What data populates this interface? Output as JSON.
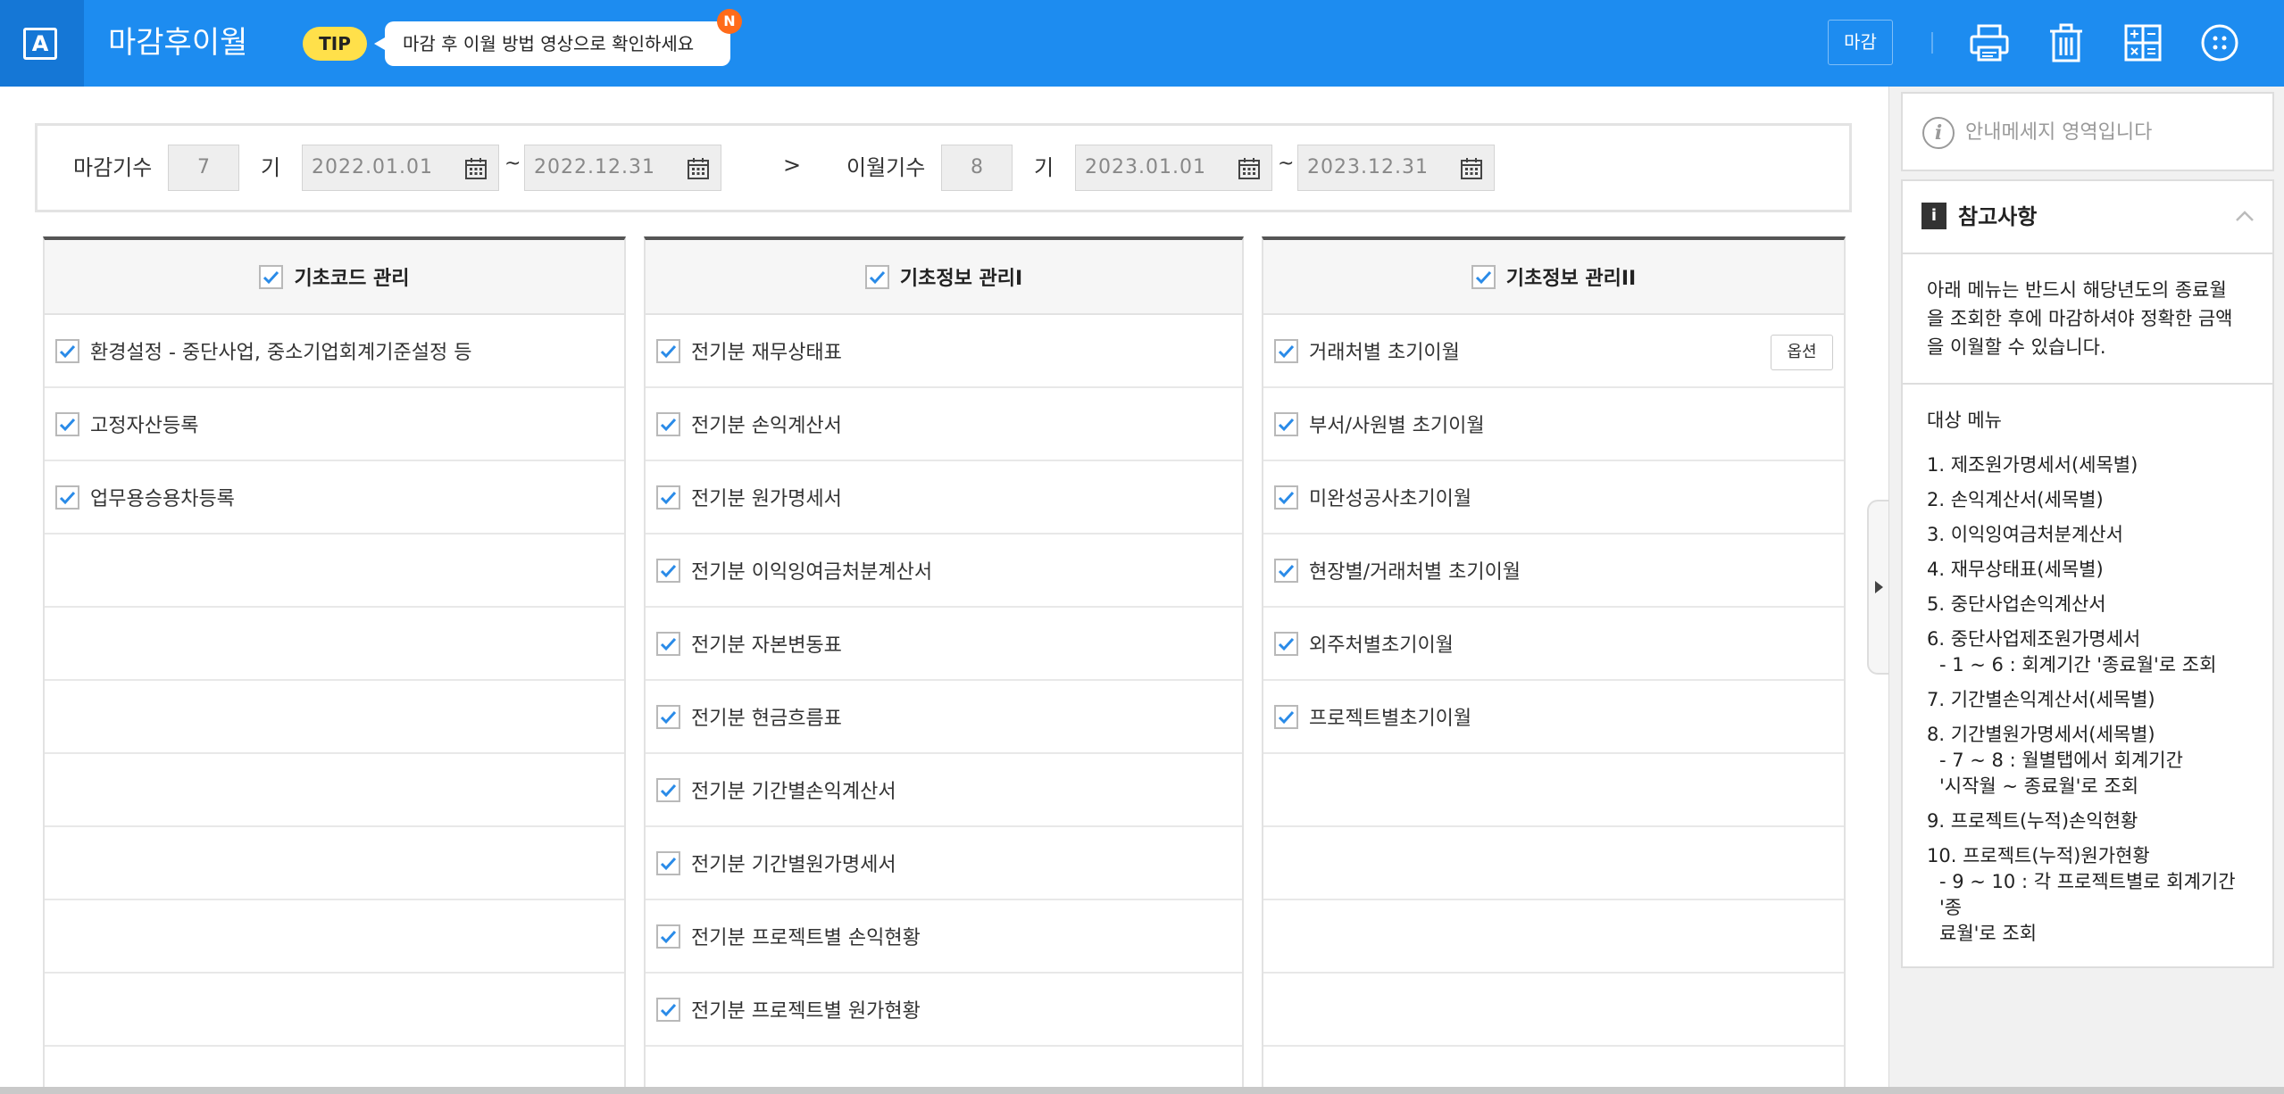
{
  "header": {
    "logo_letter": "A",
    "title": "마감후이월",
    "tip_badge": "TIP",
    "tip_message": "마감 후 이월 방법 영상으로 확인하세요",
    "new_badge": "N",
    "close_button": "마감",
    "icons": [
      "print-icon",
      "trash-icon",
      "calculator-icon",
      "more-apps-icon"
    ],
    "colors": {
      "bar": "#1d8cf0",
      "logo_bg": "#1577d6",
      "tip": "#ffe04a",
      "new_badge": "#ff6b1a"
    }
  },
  "period": {
    "close_label": "마감기수",
    "close_term": "7",
    "term_suffix": "기",
    "close_start": "2022.01.01",
    "close_end": "2022.12.31",
    "tilde": "~",
    "arrow": ">",
    "carry_label": "이월기수",
    "carry_term": "8",
    "carry_start": "2023.01.01",
    "carry_end": "2023.12.31"
  },
  "columns": [
    {
      "title": "기초코드 관리",
      "items": [
        {
          "label": "환경설정 - 중단사업, 중소기업회계기준설정 등",
          "checked": true
        },
        {
          "label": "고정자산등록",
          "checked": true
        },
        {
          "label": "업무용승용차등록",
          "checked": true
        }
      ]
    },
    {
      "title": "기초정보 관리I",
      "items": [
        {
          "label": "전기분 재무상태표",
          "checked": true
        },
        {
          "label": "전기분 손익계산서",
          "checked": true
        },
        {
          "label": "전기분 원가명세서",
          "checked": true
        },
        {
          "label": "전기분 이익잉여금처분계산서",
          "checked": true
        },
        {
          "label": "전기분 자본변동표",
          "checked": true
        },
        {
          "label": "전기분 현금흐름표",
          "checked": true
        },
        {
          "label": "전기분 기간별손익계산서",
          "checked": true
        },
        {
          "label": "전기분 기간별원가명세서",
          "checked": true
        },
        {
          "label": "전기분 프로젝트별 손익현황",
          "checked": true
        },
        {
          "label": "전기분 프로젝트별 원가현황",
          "checked": true
        }
      ]
    },
    {
      "title": "기초정보 관리II",
      "option_button": "옵션",
      "items": [
        {
          "label": "거래처별 초기이월",
          "checked": true
        },
        {
          "label": "부서/사원별 초기이월",
          "checked": true
        },
        {
          "label": "미완성공사초기이월",
          "checked": true
        },
        {
          "label": "현장별/거래처별 초기이월",
          "checked": true
        },
        {
          "label": "외주처별초기이월",
          "checked": true
        },
        {
          "label": "프로젝트별초기이월",
          "checked": true
        }
      ]
    }
  ],
  "panel": {
    "info_icon": "i",
    "info_message": "안내메세지 영역입니다",
    "ref_icon": "i",
    "ref_title": "참고사항",
    "ref_desc_lines": [
      "아래 메뉴는 반드시 해당년도의 종료월",
      "을 조회한 후에 마감하셔야 정확한 금액",
      "을 이월할 수 있습니다."
    ],
    "target_title": "대상 메뉴",
    "item_1": "1. 제조원가명세서(세목별)",
    "item_2": "2. 손익계산서(세목별)",
    "item_3": "3. 이익잉여금처분계산서",
    "item_4": "4. 재무상태표(세목별)",
    "item_5": "5. 중단사업손익계산서",
    "item_6": "6. 중단사업제조원가명세서",
    "item_6_note": "- 1 ~ 6 : 회계기간 '종료월'로 조회",
    "item_7": "7. 기간별손익계산서(세목별)",
    "item_8": "8. 기간별원가명세서(세목별)",
    "item_8_note_1": "- 7 ~ 8 : 월별탭에서 회계기간",
    "item_8_note_2": "'시작월 ~ 종료월'로 조회",
    "item_9": "9. 프로젝트(누적)손익현황",
    "item_10": "10. 프로젝트(누적)원가현황",
    "item_10_note_1": "- 9 ~ 10 : 각 프로젝트별로 회계기간 '종",
    "item_10_note_2": "료월'로 조회"
  }
}
